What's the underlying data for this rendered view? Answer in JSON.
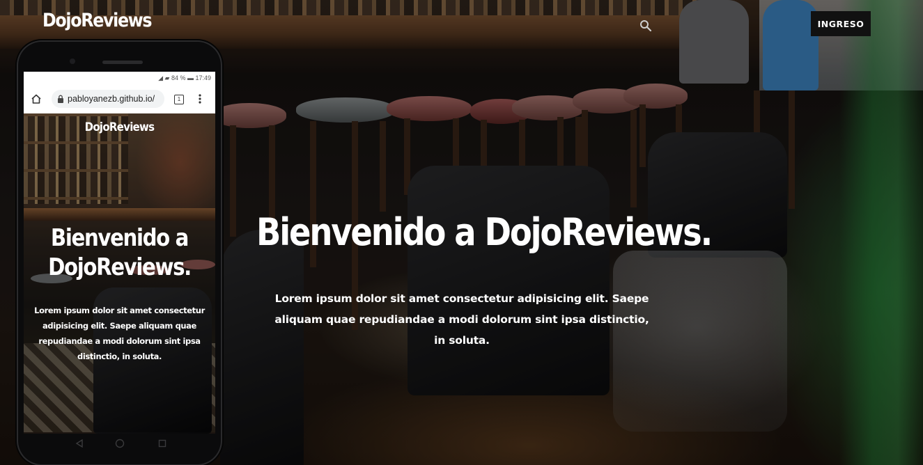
{
  "navbar": {
    "brand": "DojoReviews",
    "search_icon": "search-icon",
    "login_label": "INGRESO"
  },
  "hero": {
    "title": "Bienvenido a DojoReviews.",
    "text": "Lorem ipsum dolor sit amet consectetur adipisicing elit. Saepe aliquam quae repudiandae a modi dolorum sint ipsa distinctio, in soluta."
  },
  "phone": {
    "status": "◢ ▰ 84 % ▬ 17:49",
    "url": "pabloyanezb.github.io/",
    "tabs_count": "1",
    "brand": "DojoReviews",
    "title": "Bienvenido a DojoReviews.",
    "text": "Lorem ipsum dolor sit amet consectetur adipisicing elit. Saepe aliquam quae repudiandae a modi dolorum sint ipsa distinctio, in soluta."
  },
  "colors": {
    "button_bg": "#111111",
    "text": "#ffffff"
  }
}
